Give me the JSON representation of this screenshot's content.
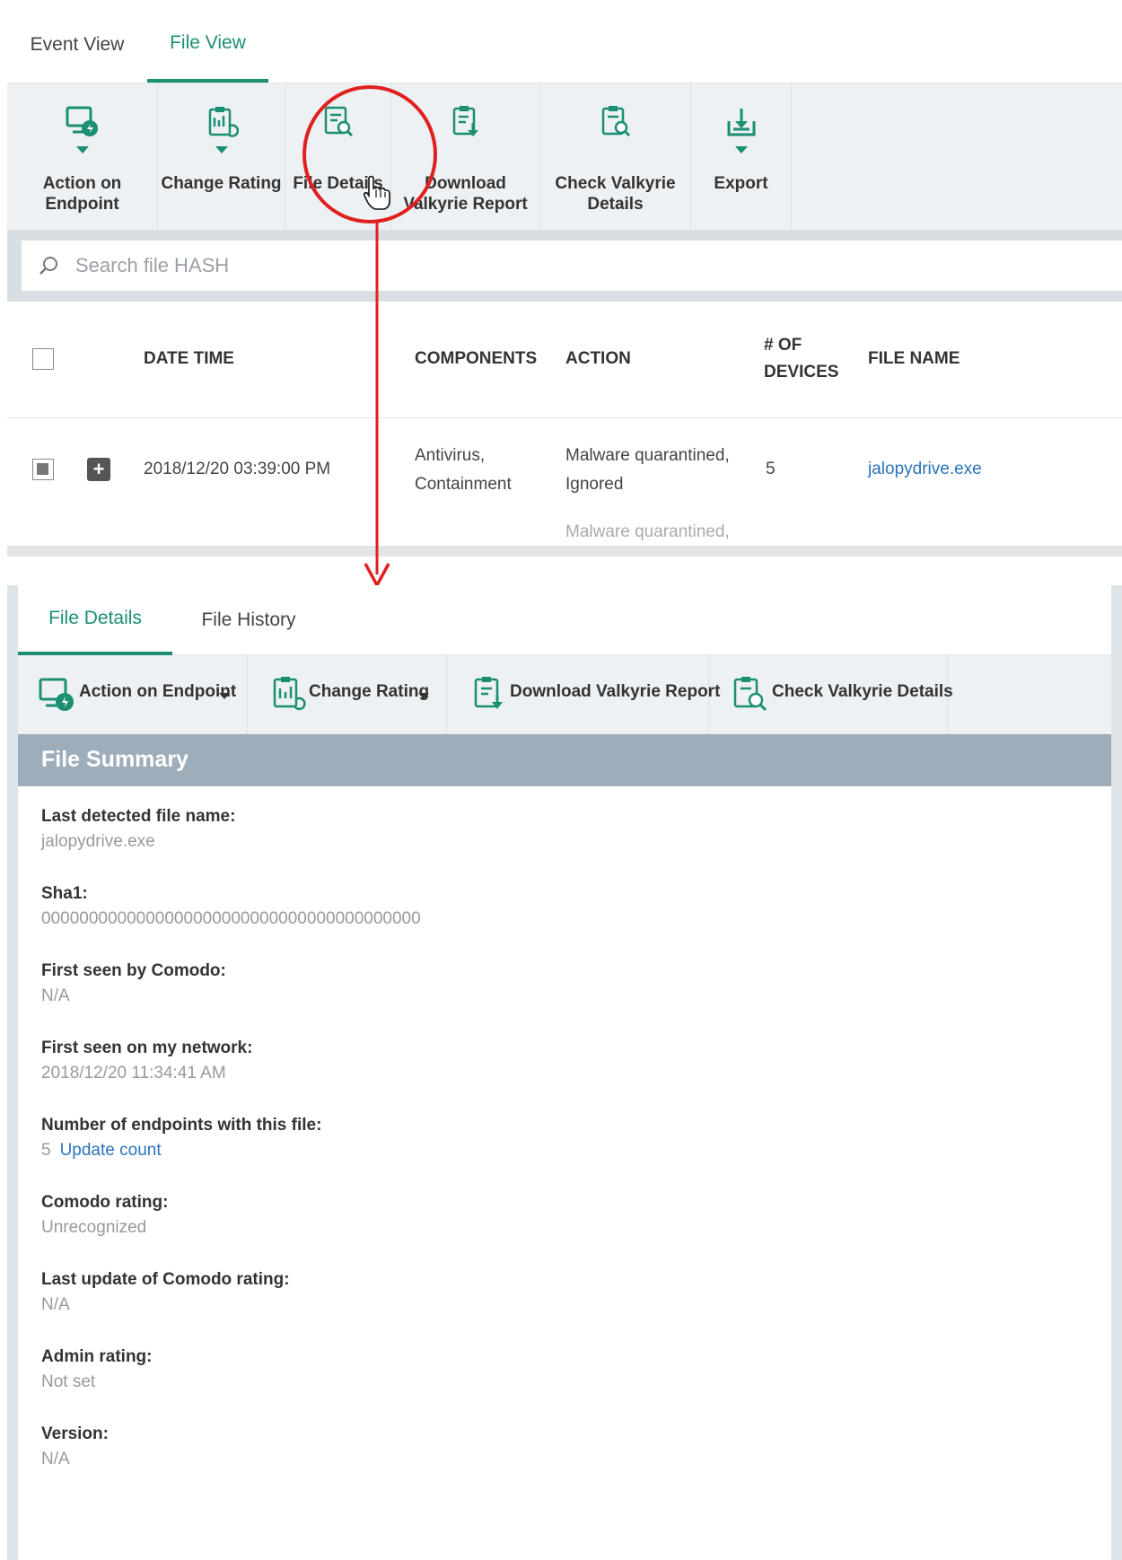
{
  "top": {
    "tabs": [
      {
        "label": "Event View",
        "active": false
      },
      {
        "label": "File View",
        "active": true
      }
    ],
    "toolbar": {
      "action_on_endpoint": "Action on\nEndpoint",
      "change_rating": "Change Rating",
      "file_details": "File Details",
      "download_valkyrie": "Download\nValkyrie Report",
      "check_valkyrie": "Check Valkyrie\nDetails",
      "export": "Export"
    },
    "search": {
      "placeholder": "Search file HASH"
    },
    "columns": {
      "date_time": "DATE TIME",
      "components": "COMPONENTS",
      "action": "ACTION",
      "devices": "# OF\nDEVICES",
      "file_name": "FILE NAME"
    },
    "row": {
      "date_time": "2018/12/20 03:39:00 PM",
      "components": "Antivirus,\nContainment",
      "action": "Malware quarantined,\nIgnored",
      "devices": "5",
      "file_name": "jalopydrive.exe",
      "next_action_partial": "Malware quarantined,"
    }
  },
  "bottom": {
    "tabs": [
      {
        "label": "File Details",
        "active": true
      },
      {
        "label": "File History",
        "active": false
      }
    ],
    "toolbar": {
      "action_on_endpoint": "Action on Endpoint",
      "change_rating": "Change Rating",
      "download_valkyrie": "Download Valkyrie Report",
      "check_valkyrie": "Check Valkyrie Details"
    },
    "summary_title": "File Summary",
    "fields": {
      "last_detected_label": "Last detected file name:",
      "last_detected_value": "jalopydrive.exe",
      "sha1_label": "Sha1:",
      "sha1_value": "0000000000000000000000000000000000000000",
      "first_seen_comodo_label": "First seen by Comodo:",
      "first_seen_comodo_value": "N/A",
      "first_seen_network_label": "First seen on my network:",
      "first_seen_network_value": "2018/12/20 11:34:41 AM",
      "endpoints_label": "Number of endpoints with this file:",
      "endpoints_value": "5",
      "endpoints_link": "Update count",
      "comodo_rating_label": "Comodo rating:",
      "comodo_rating_value": "Unrecognized",
      "last_update_label": "Last update of Comodo rating:",
      "last_update_value": "N/A",
      "admin_rating_label": "Admin rating:",
      "admin_rating_value": "Not set",
      "version_label": "Version:",
      "version_value": "N/A"
    }
  },
  "colors": {
    "accent_green": "#1a8f73",
    "annotation_red": "#e02020",
    "link_blue": "#2a73b8",
    "summary_bar": "#9eadba"
  }
}
